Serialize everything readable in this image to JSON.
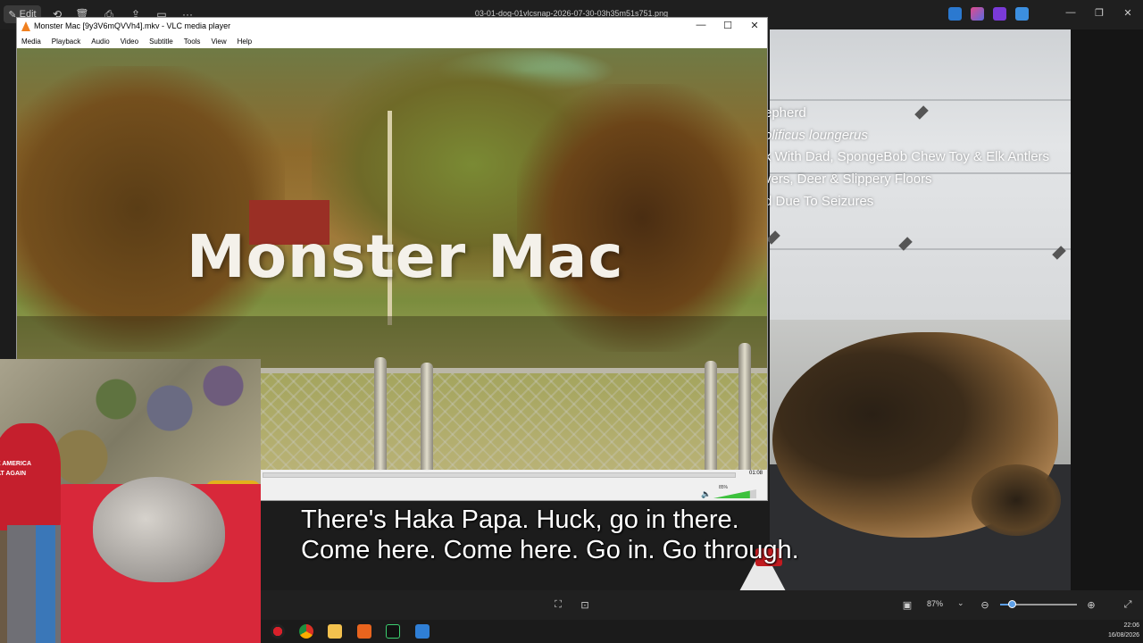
{
  "photos_viewer": {
    "edit_label": "Edit",
    "filename": "03-01-dog-01vlcsnap-2026-07-30-03h35m51s751.png",
    "zoom_value": "87%",
    "accent_color": "#5ea0e8"
  },
  "facts": [
    {
      "text": "epherd",
      "italic": false
    },
    {
      "text": "olificus loungerus",
      "italic": true
    },
    {
      "text": "k With Dad, SpongeBob Chew Toy & Elk Antlers",
      "italic": false
    },
    {
      "text": "vers, Deer & Slippery Floors",
      "italic": false
    },
    {
      "text": "d Due To Seizures",
      "italic": false
    }
  ],
  "webcam": {
    "hat_text_line1": "E AMERICA",
    "hat_text_line2": "AT AGAIN"
  },
  "vlc": {
    "title": "Monster Mac [9y3V6mQVVh4].mkv - VLC media player",
    "menu": [
      "Media",
      "Playback",
      "Audio",
      "Video",
      "Subtitle",
      "Tools",
      "View",
      "Help"
    ],
    "video_title": "Monster Mac",
    "time_total": "01:08",
    "volume_label": "85%",
    "volume_level": 0.85,
    "volume_color": "#3cc13c"
  },
  "subtitles": [
    "There's Haka Papa. Huck, go in there.",
    "Come here. Come here. Go in. Go through."
  ],
  "clock": {
    "time": "22:06",
    "date": "16/08/2026"
  },
  "icons": {
    "top_bar": [
      "edit-icon",
      "rotate-icon",
      "delete-icon",
      "print-icon",
      "share-icon",
      "slideshow-icon",
      "more-icon"
    ],
    "bottom_bar": [
      "fit-icon",
      "actual-size-icon",
      "filmstrip-icon",
      "zoom-out-icon",
      "zoom-in-icon",
      "fullscreen-icon"
    ],
    "taskbar": [
      "record-app-icon",
      "chrome-icon",
      "explorer-icon",
      "slides-app-icon",
      "terminal-icon",
      "photos-app-icon"
    ]
  }
}
